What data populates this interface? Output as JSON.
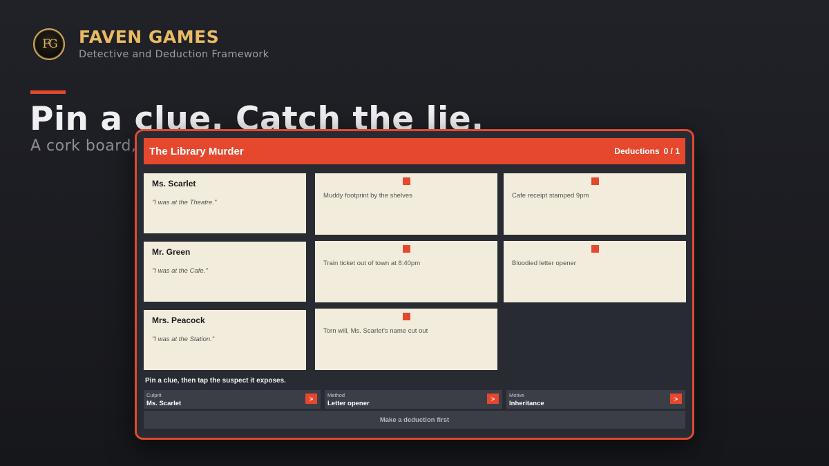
{
  "brand": {
    "logo_text": "FG",
    "name": "FAVEN GAMES",
    "subtitle": "Detective and Deduction Framework"
  },
  "hero": {
    "headline": "Pin a clue. Catch the lie.",
    "subline": "A cork board, c"
  },
  "game": {
    "title": "The Library Murder",
    "deductions_label": "Deductions",
    "deductions_count": "0 / 1",
    "suspects": [
      {
        "name": "Ms. Scarlet",
        "quote": "\"I was at the Theatre.\""
      },
      {
        "name": "Mr. Green",
        "quote": "\"I was at the Cafe.\""
      },
      {
        "name": "Mrs. Peacock",
        "quote": "\"I was at the Station.\""
      }
    ],
    "clues": [
      {
        "text": "Muddy footprint by the shelves"
      },
      {
        "text": "Cafe receipt stamped 9pm"
      },
      {
        "text": "Train ticket out of town at 8:40pm"
      },
      {
        "text": "Bloodied letter opener"
      },
      {
        "text": "Torn will, Ms. Scarlet's name cut out"
      }
    ],
    "hint": "Pin a clue, then tap the suspect it exposes.",
    "slots": [
      {
        "label": "Culprit",
        "value": "Ms. Scarlet",
        "button": ">"
      },
      {
        "label": "Method",
        "value": "Letter opener",
        "button": ">"
      },
      {
        "label": "Motive",
        "value": "Inheritance",
        "button": ">"
      }
    ],
    "submit_label": "Make a deduction first"
  },
  "colors": {
    "accent": "#e6482e",
    "brand_gold": "#e9bb63",
    "card": "#f2ecdd",
    "panel": "#292b33"
  },
  "icons": {
    "logo": "faven-games-logo",
    "pin": "pin-icon",
    "slot_button": "chevron-right-icon"
  }
}
